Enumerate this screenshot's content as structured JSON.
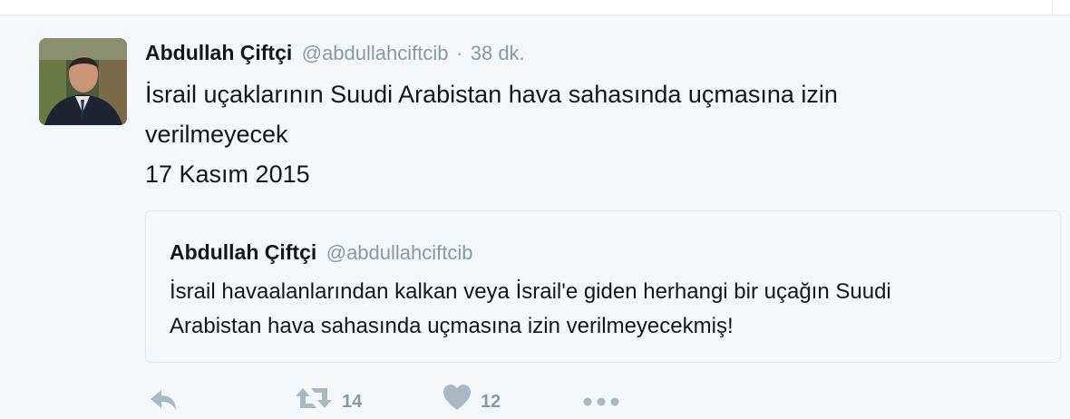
{
  "tweet": {
    "author_name": "Abdullah Çiftçi",
    "author_handle": "@abdullahciftcib",
    "separator": "·",
    "time": "38 dk.",
    "text_lines": [
      "İsrail uçaklarının Suudi Arabistan hava sahasında uçmasına izin",
      "verilmeyecek",
      "17 Kasım 2015"
    ]
  },
  "quoted_tweet": {
    "author_name": "Abdullah Çiftçi",
    "author_handle": "@abdullahciftcib",
    "text_lines": [
      "İsrail havaalanlarından kalkan veya İsrail'e giden herhangi bir uçağın Suudi",
      "Arabistan hava sahasında uçmasına izin verilmeyecekmiş!"
    ]
  },
  "actions": {
    "reply_icon": "reply-icon",
    "retweet_icon": "retweet-icon",
    "retweet_count": "14",
    "like_icon": "heart-icon",
    "like_count": "12",
    "more_icon": "more-icon"
  },
  "colors": {
    "background": "#f5f8fa",
    "text": "#14171a",
    "secondary": "#8899a6",
    "border": "#e1e8ed",
    "icon": "#aab8c2"
  }
}
